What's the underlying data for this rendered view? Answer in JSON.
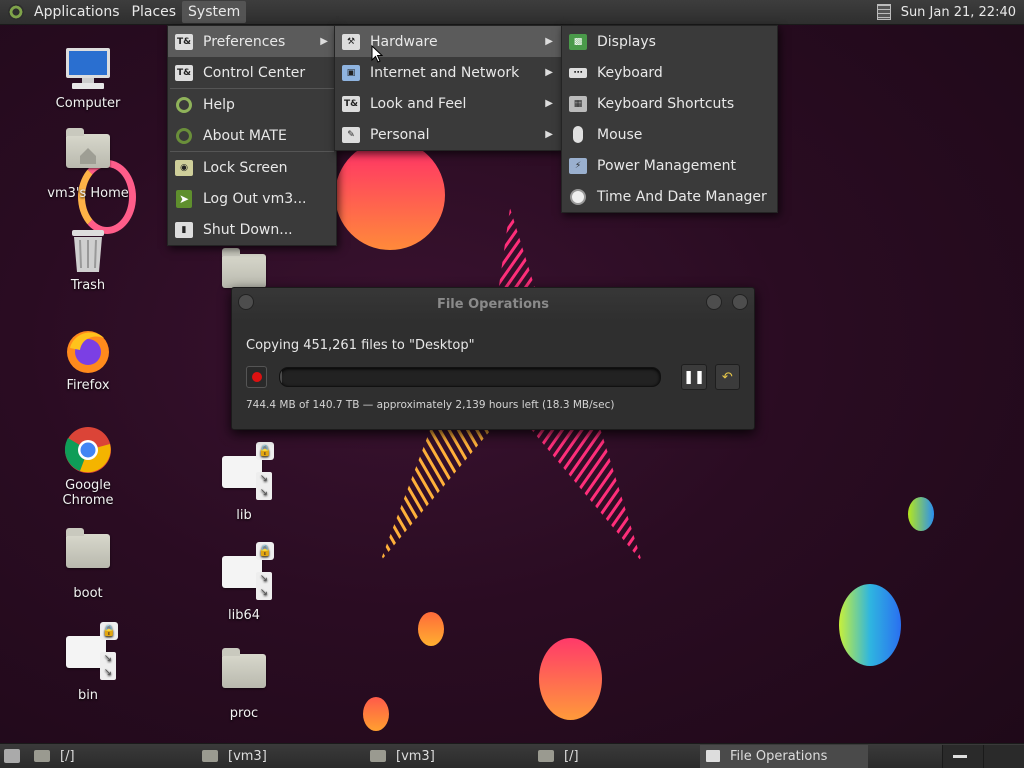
{
  "top_panel": {
    "menus": [
      "Applications",
      "Places",
      "System"
    ],
    "active_menu": "System",
    "clock": "Sun Jan 21, 22:40"
  },
  "desktop_icons": {
    "computer": "Computer",
    "home": "vm3's Home",
    "trash": "Trash",
    "firefox": "Firefox",
    "chrome": "Google Chrome",
    "boot": "boot",
    "bin": "bin",
    "lib": "lib",
    "lib64": "lib64",
    "proc": "proc"
  },
  "system_menu": {
    "items": [
      "Preferences",
      "Control Center",
      "Help",
      "About MATE",
      "Lock Screen",
      "Log Out vm3...",
      "Shut Down..."
    ]
  },
  "preferences_menu": {
    "items": [
      "Hardware",
      "Internet and Network",
      "Look and Feel",
      "Personal"
    ]
  },
  "hardware_menu": {
    "items": [
      "Displays",
      "Keyboard",
      "Keyboard Shortcuts",
      "Mouse",
      "Power Management",
      "Time And Date Manager"
    ]
  },
  "file_operations": {
    "title": "File Operations",
    "message": "Copying 451,261 files to \"Desktop\"",
    "stats": "744.4 MB of 140.7 TB — approximately 2,139 hours left (18.3 MB/sec)",
    "progress_fraction": 0.005
  },
  "taskbar": {
    "tasks": [
      "[/]",
      "[vm3]",
      "[vm3]",
      "[/]",
      "File Operations"
    ]
  },
  "colors": {
    "panel": "#2e2e2e",
    "menu_bg": "#3a3a3a",
    "menu_highlight": "#5b5b5b",
    "record_red": "#dd1111"
  }
}
